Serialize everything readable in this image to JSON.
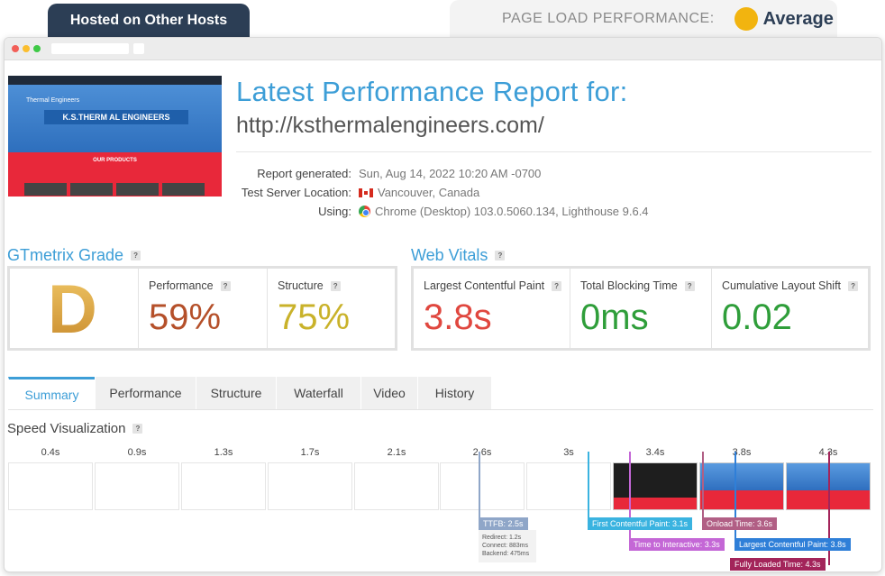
{
  "header": {
    "host_tab": "Hosted on Other Hosts",
    "perf_label": "PAGE LOAD PERFORMANCE:",
    "perf_value": "Average",
    "perf_color": "#f2b40f"
  },
  "thumbnail": {
    "logo_text": "Thermal Engineers",
    "sign_text": "K.S.THERM AL ENGINEERS",
    "products_text": "OUR PRODUCTS"
  },
  "report": {
    "title": "Latest Performance Report for:",
    "url": "http://ksthermalengineers.com/",
    "generated_label": "Report generated:",
    "generated_value": "Sun, Aug 14, 2022 10:20 AM -0700",
    "location_label": "Test Server Location:",
    "location_value": "Vancouver, Canada",
    "using_label": "Using:",
    "using_value": "Chrome (Desktop) 103.0.5060.134, Lighthouse 9.6.4"
  },
  "grade": {
    "title": "GTmetrix Grade",
    "letter": "D",
    "performance_label": "Performance",
    "performance_value": "59%",
    "performance_color": "#b5502a",
    "structure_label": "Structure",
    "structure_value": "75%",
    "structure_color": "#c9b22a"
  },
  "vitals": {
    "title": "Web Vitals",
    "lcp_label": "Largest Contentful Paint",
    "lcp_value": "3.8s",
    "lcp_color": "#e0473f",
    "tbt_label": "Total Blocking Time",
    "tbt_value": "0ms",
    "tbt_color": "#2f9e3a",
    "cls_label": "Cumulative Layout Shift",
    "cls_value": "0.02",
    "cls_color": "#2f9e3a"
  },
  "tabs": [
    "Summary",
    "Performance",
    "Structure",
    "Waterfall",
    "Video",
    "History"
  ],
  "speed": {
    "title": "Speed Visualization",
    "frames": [
      "0.4s",
      "0.9s",
      "1.3s",
      "1.7s",
      "2.1s",
      "2.6s",
      "3s",
      "3.4s",
      "3.8s",
      "4.3s"
    ],
    "ttfb": "TTFB: 2.5s",
    "ttfb_redirect": "Redirect: 1.2s",
    "ttfb_connect": "Connect: 883ms",
    "ttfb_backend": "Backend: 475ms",
    "fcp": "First Contentful Paint: 3.1s",
    "onload": "Onload Time: 3.6s",
    "tti": "Time to Interactive: 3.3s",
    "lcp": "Largest Contentful Paint: 3.8s",
    "fully_loaded": "Fully Loaded Time: 4.3s"
  }
}
